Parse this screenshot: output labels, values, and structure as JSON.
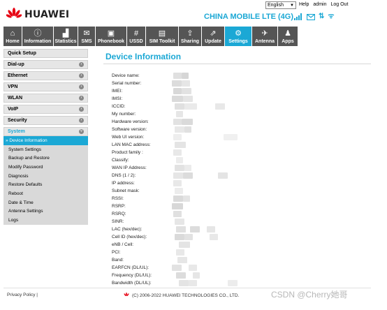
{
  "brand": {
    "name": "HUAWEI",
    "color": "#e60012"
  },
  "accent": "#1ba8d5",
  "top": {
    "language": "English",
    "links": [
      "Help",
      "admin",
      "Log Out"
    ]
  },
  "status": {
    "carrier": "CHINA MOBILE",
    "network": "LTE (4G)",
    "icons": [
      "signal-icon",
      "sms-icon",
      "data-transfer-icon",
      "wifi-icon"
    ]
  },
  "nav": [
    {
      "label": "Home",
      "icon": "home-icon",
      "glyph": "⌂"
    },
    {
      "label": "Information",
      "icon": "info-icon",
      "glyph": "ⓘ"
    },
    {
      "label": "Statistics",
      "icon": "statistics-icon",
      "glyph": "▟"
    },
    {
      "label": "SMS",
      "icon": "sms-icon",
      "glyph": "✉"
    },
    {
      "label": "Phonebook",
      "icon": "phonebook-icon",
      "glyph": "▣"
    },
    {
      "label": "USSD",
      "icon": "ussd-icon",
      "glyph": "#"
    },
    {
      "label": "SIM Toolkit",
      "icon": "sim-toolkit-icon",
      "glyph": "▤"
    },
    {
      "label": "Sharing",
      "icon": "sharing-icon",
      "glyph": "⇪"
    },
    {
      "label": "Update",
      "icon": "update-icon",
      "glyph": "⇗"
    },
    {
      "label": "Settings",
      "icon": "settings-icon",
      "glyph": "⚙"
    },
    {
      "label": "Antenna",
      "icon": "antenna-icon",
      "glyph": "✈"
    },
    {
      "label": "Apps",
      "icon": "android-icon",
      "glyph": "♟"
    }
  ],
  "sidebar": {
    "groups": [
      "Quick Setup",
      "Dial-up",
      "Ethernet",
      "VPN",
      "WLAN",
      "VoIP",
      "Security"
    ],
    "open_group": "System",
    "subitems": [
      "» Device Information",
      "System Settings",
      "Backup and Restore",
      "Modify Password",
      "Diagnosis",
      "Restore Defaults",
      "Reboot",
      "Date & Time",
      "Antenna Settings",
      "Logs"
    ]
  },
  "page": {
    "title": "Device Information",
    "fields": [
      "Device name:",
      "Serial number:",
      "IMEI:",
      "IMSI:",
      "ICCID:",
      "My number:",
      "Hardware version:",
      "Software version:",
      "Web UI version:",
      "LAN MAC address:",
      "Product family :",
      "Classify:",
      "WAN IP Address:",
      "DNS (1 / 2):",
      "IP address:",
      "Subnet mask:",
      "RSSI:",
      "RSRP:",
      "RSRQ:",
      "SINR:",
      "LAC (hex/dec):",
      "Cell ID (hex/dec):",
      "eNB / Cell:",
      "PCI:",
      "Band:",
      "EARFCN (DL/UL):",
      "Frequency (DL/UL):",
      "Bandwidth (DL/UL):"
    ]
  },
  "footer": {
    "privacy": "Privacy Policy",
    "copyright": "(C) 2006-2022 HUAWEI TECHNOLOGIES CO., LTD.",
    "watermark": "CSDN @Cherry她哥"
  }
}
